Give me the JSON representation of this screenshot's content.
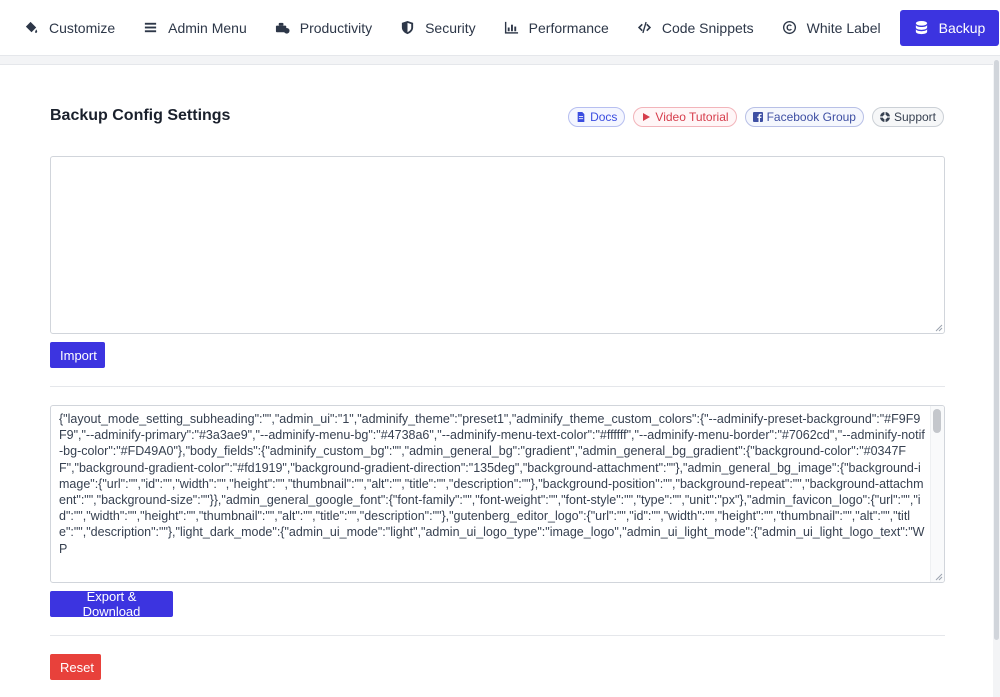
{
  "nav": {
    "tabs": [
      {
        "label": "Customize",
        "icon": "paint-bucket-icon",
        "active": false
      },
      {
        "label": "Admin Menu",
        "icon": "menu-lines-icon",
        "active": false
      },
      {
        "label": "Productivity",
        "icon": "toolbox-icon",
        "active": false
      },
      {
        "label": "Security",
        "icon": "shield-icon",
        "active": false
      },
      {
        "label": "Performance",
        "icon": "bar-chart-icon",
        "active": false
      },
      {
        "label": "Code Snippets",
        "icon": "code-icon",
        "active": false
      },
      {
        "label": "White Label",
        "icon": "copyright-icon",
        "active": false
      },
      {
        "label": "Backup",
        "icon": "database-icon",
        "active": true
      }
    ]
  },
  "page": {
    "title": "Backup Config Settings"
  },
  "links": {
    "docs": "Docs",
    "video": "Video Tutorial",
    "facebook": "Facebook Group",
    "support": "Support"
  },
  "import": {
    "value": "",
    "button": "Import"
  },
  "export": {
    "value": "{\"layout_mode_setting_subheading\":\"\",\"admin_ui\":\"1\",\"adminify_theme\":\"preset1\",\"adminify_theme_custom_colors\":{\"--adminify-preset-background\":\"#F9F9F9\",\"--adminify-primary\":\"#3a3ae9\",\"--adminify-menu-bg\":\"#4738a6\",\"--adminify-menu-text-color\":\"#ffffff\",\"--adminify-menu-border\":\"#7062cd\",\"--adminify-notif-bg-color\":\"#FD49A0\"},\"body_fields\":{\"adminify_custom_bg\":\"\",\"admin_general_bg\":\"gradient\",\"admin_general_bg_gradient\":{\"background-color\":\"#0347FF\",\"background-gradient-color\":\"#fd1919\",\"background-gradient-direction\":\"135deg\",\"background-attachment\":\"\"},\"admin_general_bg_image\":{\"background-image\":{\"url\":\"\",\"id\":\"\",\"width\":\"\",\"height\":\"\",\"thumbnail\":\"\",\"alt\":\"\",\"title\":\"\",\"description\":\"\"},\"background-position\":\"\",\"background-repeat\":\"\",\"background-attachment\":\"\",\"background-size\":\"\"}},\"admin_general_google_font\":{\"font-family\":\"\",\"font-weight\":\"\",\"font-style\":\"\",\"type\":\"\",\"unit\":\"px\"},\"admin_favicon_logo\":{\"url\":\"\",\"id\":\"\",\"width\":\"\",\"height\":\"\",\"thumbnail\":\"\",\"alt\":\"\",\"title\":\"\",\"description\":\"\"},\"gutenberg_editor_logo\":{\"url\":\"\",\"id\":\"\",\"width\":\"\",\"height\":\"\",\"thumbnail\":\"\",\"alt\":\"\",\"title\":\"\",\"description\":\"\"},\"light_dark_mode\":{\"admin_ui_mode\":\"light\",\"admin_ui_logo_type\":\"image_logo\",\"admin_ui_light_mode\":{\"admin_ui_light_logo_text\":\"WP",
    "button": "Export & Download"
  },
  "reset": {
    "button": "Reset"
  },
  "colors": {
    "primary": "#3c34e0",
    "danger": "#e8413b"
  }
}
